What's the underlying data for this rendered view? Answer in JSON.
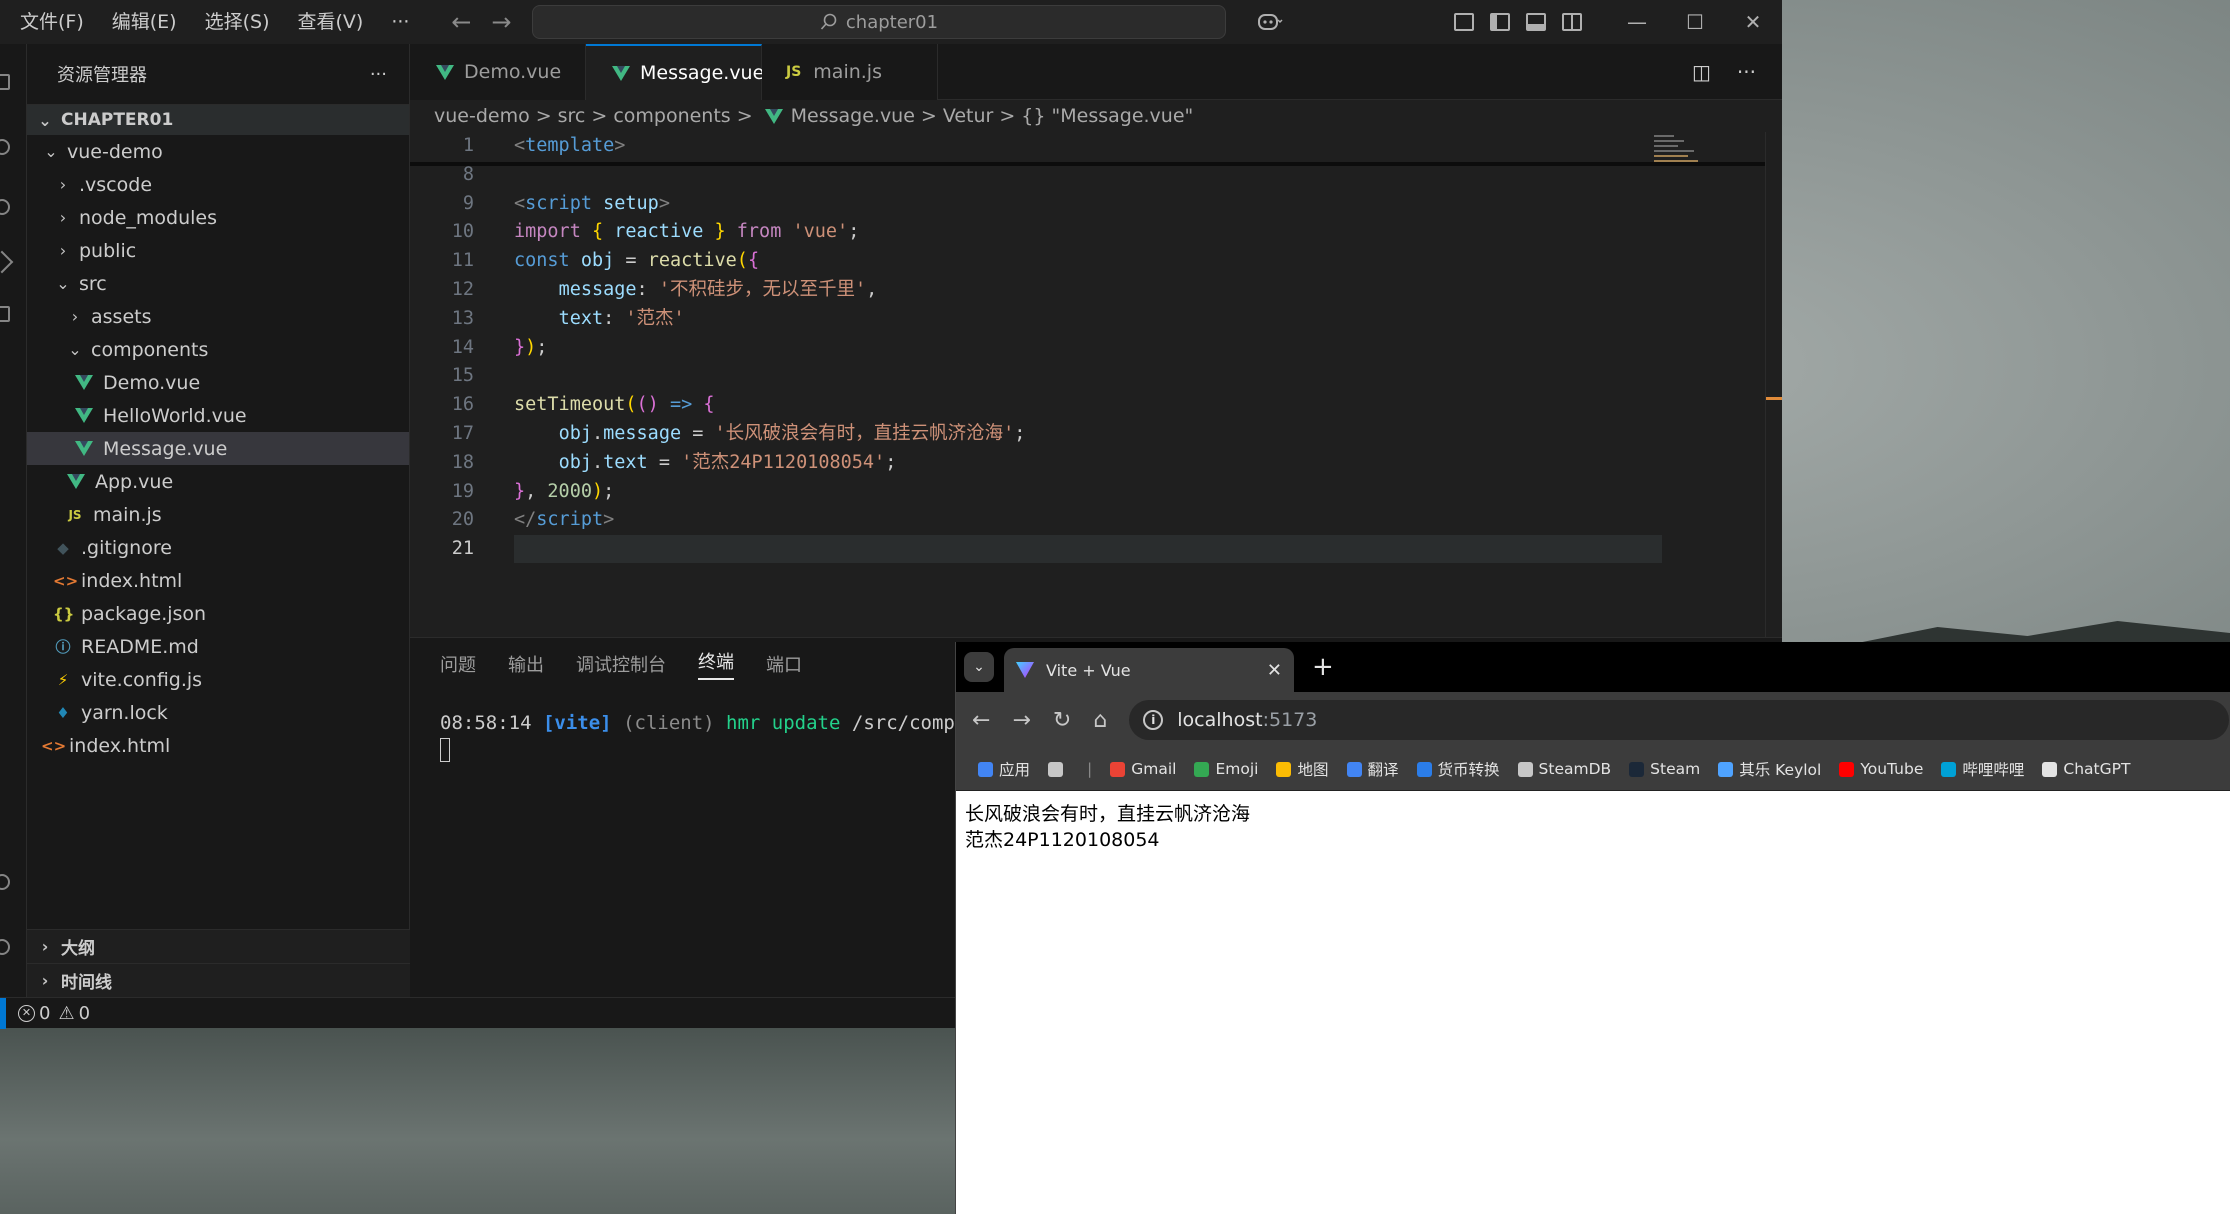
{
  "window": {
    "menu": [
      "文件(F)",
      "编辑(E)",
      "选择(S)",
      "查看(V)",
      "···"
    ],
    "search_text": "chapter01",
    "window_controls": [
      "—",
      "☐",
      "✕"
    ]
  },
  "sidebar": {
    "title": "资源管理器",
    "more": "···",
    "root": "CHAPTER01",
    "tree": [
      {
        "label": "vue-demo",
        "indent": 1,
        "kind": "folder-open"
      },
      {
        "label": ".vscode",
        "indent": 2,
        "kind": "folder"
      },
      {
        "label": "node_modules",
        "indent": 2,
        "kind": "folder"
      },
      {
        "label": "public",
        "indent": 2,
        "kind": "folder"
      },
      {
        "label": "src",
        "indent": 2,
        "kind": "folder-open"
      },
      {
        "label": "assets",
        "indent": 3,
        "kind": "folder"
      },
      {
        "label": "components",
        "indent": 3,
        "kind": "folder-open"
      },
      {
        "label": "Demo.vue",
        "indent": 4,
        "kind": "vue"
      },
      {
        "label": "HelloWorld.vue",
        "indent": 4,
        "kind": "vue"
      },
      {
        "label": "Message.vue",
        "indent": 4,
        "kind": "vue",
        "active": true
      },
      {
        "label": "App.vue",
        "indent": 3,
        "kind": "vue"
      },
      {
        "label": "main.js",
        "indent": 3,
        "kind": "js"
      },
      {
        "label": ".gitignore",
        "indent": 2,
        "kind": "git"
      },
      {
        "label": "index.html",
        "indent": 2,
        "kind": "html"
      },
      {
        "label": "package.json",
        "indent": 2,
        "kind": "json"
      },
      {
        "label": "README.md",
        "indent": 2,
        "kind": "info"
      },
      {
        "label": "vite.config.js",
        "indent": 2,
        "kind": "vite"
      },
      {
        "label": "yarn.lock",
        "indent": 2,
        "kind": "yarn"
      },
      {
        "label": "index.html",
        "indent": 1,
        "kind": "html"
      }
    ],
    "outline": "大纲",
    "timeline": "时间线"
  },
  "editor": {
    "tabs": [
      {
        "label": "Demo.vue",
        "kind": "vue"
      },
      {
        "label": "Message.vue",
        "kind": "vue",
        "active": true,
        "close": "✕"
      },
      {
        "label": "main.js",
        "kind": "js"
      }
    ],
    "js_badge": "JS",
    "breadcrumb": [
      "vue-demo",
      ">",
      "src",
      ">",
      "components",
      ">",
      "Message.vue",
      ">",
      "Vetur",
      ">",
      "{} \"Message.vue\""
    ],
    "line_numbers": [
      "1",
      "8",
      "9",
      "10",
      "11",
      "12",
      "13",
      "14",
      "15",
      "16",
      "17",
      "18",
      "19",
      "20",
      "21"
    ]
  },
  "panel": {
    "tabs": [
      "问题",
      "输出",
      "调试控制台",
      "终端",
      "端口"
    ],
    "active_tab": "终端",
    "terminal": {
      "time": "08:58:14",
      "tag": "[vite]",
      "client": "(client)",
      "action": "hmr update",
      "path": "/src/compon"
    }
  },
  "status": {
    "errors": "0",
    "warnings": "0"
  },
  "browser": {
    "tab_title": "Vite + Vue",
    "tab_close": "✕",
    "new_tab": "+",
    "url_host": "localhost",
    "url_port": ":5173",
    "bookmarks": [
      {
        "label": "应用",
        "color": "#4285f4"
      },
      {
        "label": "",
        "color": "#c7c7c7"
      },
      {
        "label": "Gmail",
        "color": "#ea4335"
      },
      {
        "label": "Emoji",
        "color": "#34a853"
      },
      {
        "label": "地图",
        "color": "#fbbc04"
      },
      {
        "label": "翻译",
        "color": "#4285f4"
      },
      {
        "label": "货币转换",
        "color": "#2b7de9"
      },
      {
        "label": "SteamDB",
        "color": "#c7c7c7"
      },
      {
        "label": "Steam",
        "color": "#1b2838"
      },
      {
        "label": "其乐 Keylol",
        "color": "#4fa3ff"
      },
      {
        "label": "YouTube",
        "color": "#ff0000"
      },
      {
        "label": "哔哩哔哩",
        "color": "#00a1d6"
      },
      {
        "label": "ChatGPT",
        "color": "#e3e3e3"
      }
    ],
    "page_lines": [
      "长风破浪会有时，直挂云帆济沧海",
      "范杰24P1120108054"
    ]
  }
}
